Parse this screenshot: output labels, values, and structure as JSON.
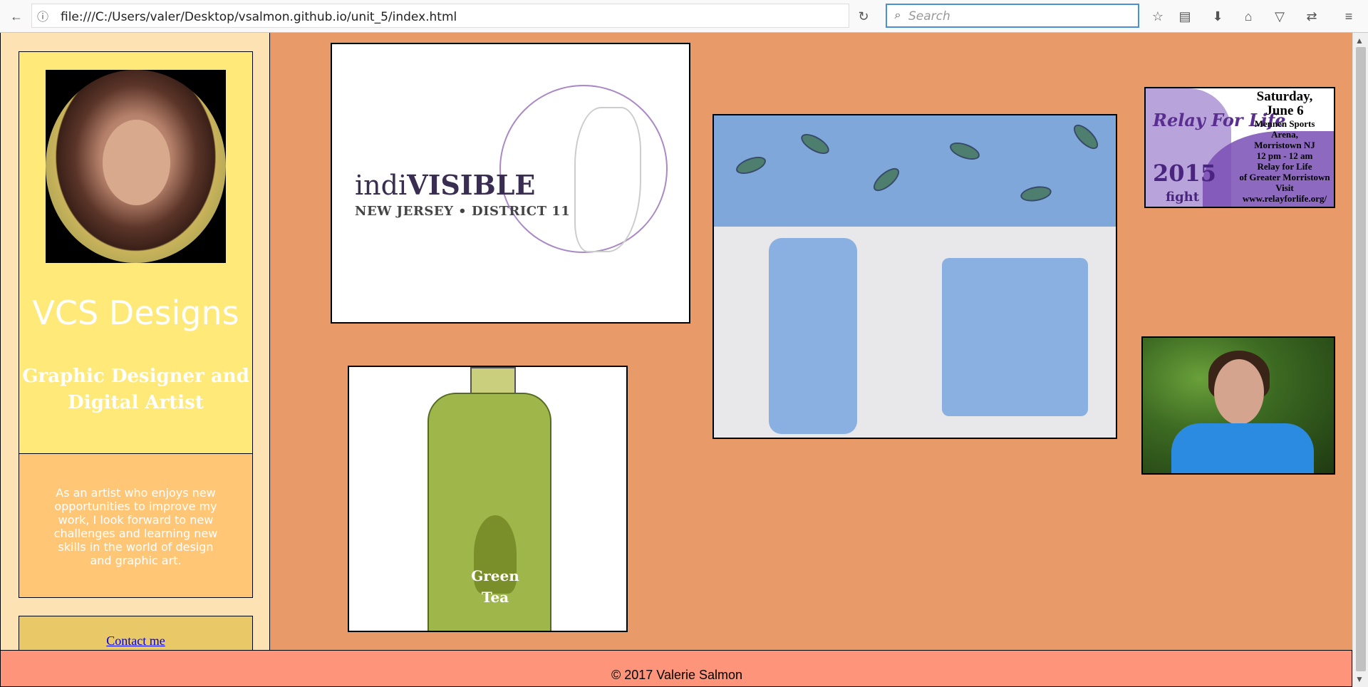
{
  "browser": {
    "url": "file:///C:/Users/valer/Desktop/vsalmon.github.io/unit_5/index.html",
    "search_placeholder": "Search",
    "icons": {
      "back": "←",
      "info": "ⓘ",
      "reload": "↻",
      "bookmark": "☆",
      "reader": "▤",
      "download": "⬇",
      "home": "⌂",
      "pocket": "▽",
      "sync": "⇄",
      "menu": "≡",
      "search": "⌕"
    }
  },
  "sidebar": {
    "title": "VCS Designs",
    "subtitle": "Graphic Designer and Digital Artist",
    "about": "As an artist who enjoys new opportunities to improve my work, I look forward to new challenges and learning new skills in the world of design and graphic art.",
    "contact_label": "Contact me"
  },
  "gallery": {
    "indivisible": {
      "word_plain": "indi",
      "word_bold": "VISIBLE",
      "line2": "NEW JERSEY • DISTRICT 11"
    },
    "relay": {
      "script": "Relay For Life",
      "year": "2015",
      "fight": "fight",
      "day": "Saturday,",
      "date": "June 6",
      "venue1": "Mennen Sports",
      "venue2": "Arena,",
      "city": "Morristown NJ",
      "time": "12 pm - 12 am",
      "org1": "Relay for Life",
      "org2": "of Greater Morristown",
      "visit": "Visit",
      "site": "www.relayforlife.org/"
    },
    "bottle": {
      "label1": "Green",
      "label2": "Tea"
    }
  },
  "footer": {
    "copyright": "© 2017 Valerie Salmon"
  },
  "colors": {
    "page_bg": "#e89a68",
    "sidebar_bg": "#fde3b4",
    "profile_bg": "#ffe978",
    "about_bg": "#ffc676",
    "contact_bg": "#e8c867",
    "footer_bg": "#fe957a"
  }
}
